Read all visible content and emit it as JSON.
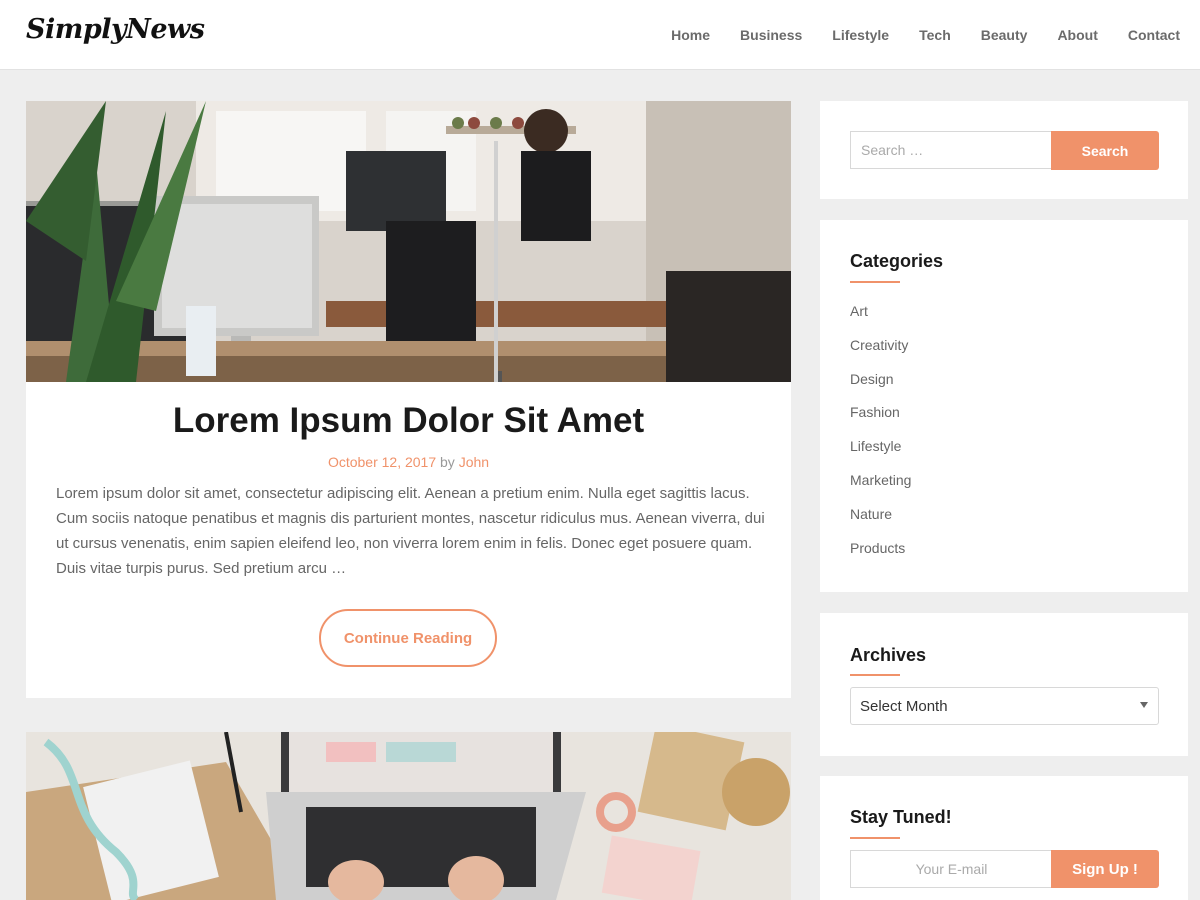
{
  "site": {
    "logo": "SimplyNews"
  },
  "nav": {
    "items": [
      "Home",
      "Business",
      "Lifestyle",
      "Tech",
      "Beauty",
      "About",
      "Contact"
    ]
  },
  "colors": {
    "accent": "#f0926a",
    "background": "#eeeeee"
  },
  "posts": [
    {
      "title": "Lorem Ipsum Dolor Sit Amet",
      "date": "October 12, 2017",
      "by": "by",
      "author": "John",
      "excerpt": "Lorem ipsum dolor sit amet, consectetur adipiscing elit. Aenean a pretium enim. Nulla eget sagittis lacus. Cum sociis natoque penatibus et magnis dis parturient montes, nascetur ridiculus mus. Aenean viverra, dui ut cursus venenatis, enim sapien eleifend leo, non viverra lorem enim in felis. Donec eget posuere quam. Duis vitae turpis purus. Sed pretium arcu …",
      "read_more": "Continue Reading"
    }
  ],
  "sidebar": {
    "search": {
      "placeholder": "Search …",
      "button": "Search"
    },
    "categories": {
      "title": "Categories",
      "items": [
        "Art",
        "Creativity",
        "Design",
        "Fashion",
        "Lifestyle",
        "Marketing",
        "Nature",
        "Products"
      ]
    },
    "archives": {
      "title": "Archives",
      "selected": "Select Month"
    },
    "newsletter": {
      "title": "Stay Tuned!",
      "placeholder": "Your E-mail",
      "button": "Sign Up !"
    }
  }
}
